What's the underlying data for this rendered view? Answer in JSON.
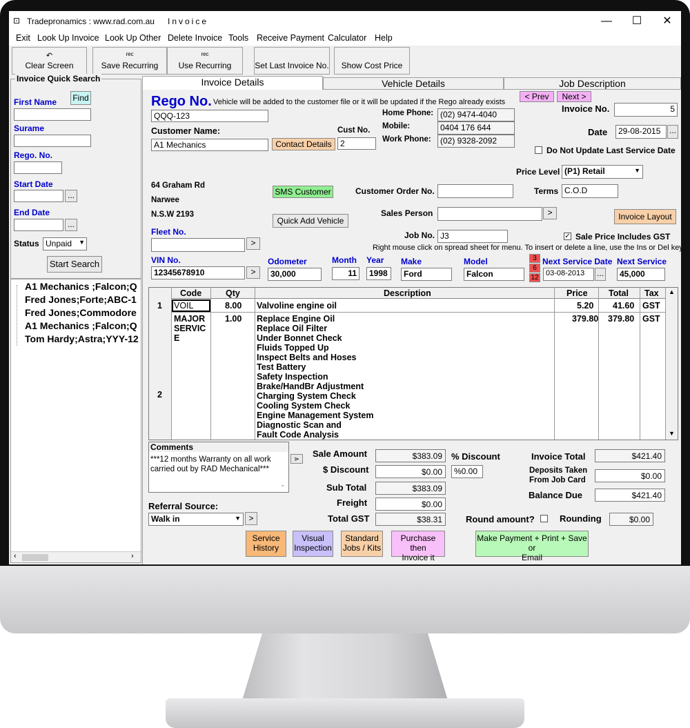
{
  "window": {
    "title": "Tradepronamics :  www.rad.com.au",
    "subtitle": "Invoice",
    "minimize": "—",
    "maximize": "☐",
    "close": "✕"
  },
  "menu": [
    "Exit",
    "Look Up Invoice",
    "Look Up Other",
    "Delete Invoice",
    "Tools",
    "Receive Payment",
    "Calculator",
    "Help"
  ],
  "toolbar": {
    "clear_screen": "Clear Screen",
    "save_recurring": "Save  Recurring",
    "use_recurring": "Use Recurring",
    "set_last_invoice": "Set Last Invoice No.",
    "show_cost_price": "Show Cost Price",
    "rec_label": "rec"
  },
  "quick_search": {
    "title": "Invoice Quick Search",
    "find": "Find",
    "first_name": "First Name",
    "surname": "Surame",
    "rego": "Rego. No.",
    "start_date": "Start Date",
    "end_date": "End Date",
    "status_label": "Status",
    "status_value": "Unpaid",
    "start_search": "Start Search",
    "ellipsis": "..."
  },
  "results": [
    "A1 Mechanics ;Falcon;Q",
    "Fred Jones;Forte;ABC-1",
    "Fred Jones;Commodore",
    "A1 Mechanics ;Falcon;Q",
    "Tom Hardy;Astra;YYY-12"
  ],
  "tabs": [
    "Invoice Details",
    "Vehicle Details",
    "Job Description"
  ],
  "invoice": {
    "rego_title": "Rego No.",
    "rego_note": "Vehicle will be added to the customer file or it will be updated if the Rego already exists",
    "rego_value": "QQQ-123",
    "customer_name_label": "Customer Name:",
    "customer_name": "A1 Mechanics",
    "contact_details": "Contact Details",
    "cust_no_label": "Cust No.",
    "cust_no": "2",
    "home_phone_label": "Home Phone:",
    "home_phone": "(02) 9474-4040",
    "mobile_label": "Mobile:",
    "mobile": "0404 176 644",
    "work_phone_label": "Work Phone:",
    "work_phone": "(02) 9328-2092",
    "prev": "< Prev",
    "next": "Next >",
    "invoice_no_label": "Invoice No.",
    "invoice_no": "5",
    "date_label": "Date",
    "date": "29-08-2015",
    "no_update_label": "Do Not Update Last Service Date",
    "price_level_label": "Price Level",
    "price_level": "(P1) Retail",
    "address1": "64 Graham Rd",
    "address2": "Narwee",
    "address3": "N.S.W  2193",
    "sms_customer": "SMS Customer",
    "quick_add_vehicle": "Quick Add Vehicle",
    "cust_order_label": "Customer Order No.",
    "terms_label": "Terms",
    "terms": "C.O.D",
    "sales_person_label": "Sales Person",
    "invoice_layout": "Invoice Layout",
    "fleet_label": "Fleet No.",
    "job_no_label": "Job No.",
    "job_no": "J3",
    "sale_price_gst": "Sale Price Includes GST",
    "right_click_note": "Right mouse click on spread sheet for menu. To insert or delete a line, use the Ins or Del key.",
    "vin_label": "VIN No.",
    "vin": "12345678910",
    "odometer_label": "Odometer",
    "odometer": "30,000",
    "month_label": "Month",
    "month": "11",
    "year_label": "Year",
    "year": "1998",
    "make_label": "Make",
    "make": "Ford",
    "model_label": "Model",
    "model": "Falcon",
    "svc_3": "3",
    "svc_6": "6",
    "svc_12": "12",
    "next_service_date_label": "Next Service Date",
    "next_service_date": "03-08-2013",
    "next_service_km_label": "Next Service Km",
    "next_service_km": "45,000"
  },
  "grid": {
    "headers": [
      "Code",
      "Qty",
      "Description",
      "Price",
      "Total",
      "Tax"
    ],
    "row1": {
      "num": "1",
      "code": "VOIL",
      "qty": "8.00",
      "desc": "Valvoline engine oil",
      "price": "5.20",
      "total": "41.60",
      "tax": "GST"
    },
    "row2": {
      "num": "2",
      "code1": "MAJOR",
      "code2": "SERVIC",
      "code3": "E",
      "qty": "1.00",
      "price": "379.80",
      "total": "379.80",
      "tax": "GST",
      "desc": [
        "Replace Engine Oil",
        "Replace Oil Filter",
        "Under Bonnet Check",
        "Fluids Topped Up",
        "Inspect Belts and Hoses",
        "Test Battery",
        "Safety Inspection",
        "Brake/HandBr Adjustment",
        "Charging System Check",
        "Cooling System Check",
        "Engine Management System",
        "Diagnostic Scan and",
        "Fault Code Analysis"
      ]
    }
  },
  "totals": {
    "comments_label": "Comments",
    "comments": "***12 months Warranty on all work carried out by RAD Mechanical***",
    "sale_amount_label": "Sale Amount",
    "sale_amount": "$383.09",
    "discount_label": "$ Discount",
    "discount": "$0.00",
    "pct_discount_label": "% Discount",
    "pct_discount": "%0.00",
    "subtotal_label": "Sub Total",
    "subtotal": "$383.09",
    "freight_label": "Freight",
    "freight": "$0.00",
    "total_gst_label": "Total GST",
    "total_gst": "$38.31",
    "invoice_total_label": "Invoice Total",
    "invoice_total": "$421.40",
    "deposits_label1": "Deposits Taken",
    "deposits_label2": "From Job Card",
    "deposits": "$0.00",
    "balance_due_label": "Balance Due",
    "balance_due": "$421.40",
    "round_label": "Round amount?",
    "rounding_label": "Rounding",
    "rounding": "$0.00",
    "referral_label": "Referral Source:",
    "referral": "Walk in"
  },
  "actions": {
    "service_history1": "Service",
    "service_history2": "History",
    "visual1": "Visual",
    "visual2": "Inspection",
    "standard1": "Standard",
    "standard2": "Jobs / Kits",
    "purchase1": "Purchase then",
    "purchase2": "Invoice it",
    "payment1": "Make Payment + Print + Save or",
    "payment2": "Email"
  },
  "colors": {
    "blue_label": "#0000cc",
    "sms_green": "#90ee90",
    "contact_orange": "#f8d0a8",
    "prev_pink": "#f4b0f4",
    "service_orange": "#f8b878",
    "visual_purple": "#c8c0f8",
    "standard_peach": "#f8d0a8",
    "purchase_pink": "#f8c0f8",
    "payment_green": "#b8f8b8",
    "svc_red": "#f05050"
  }
}
